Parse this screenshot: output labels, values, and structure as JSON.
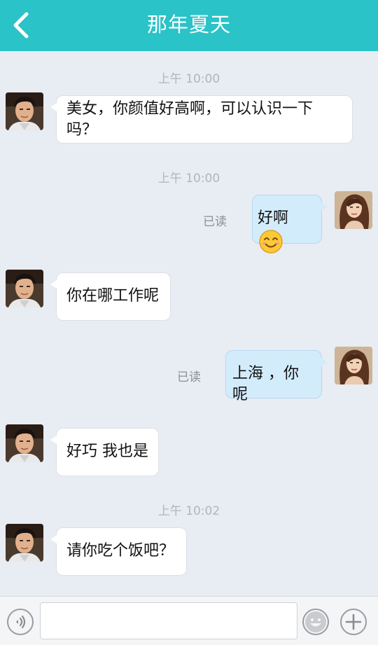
{
  "header": {
    "title": "那年夏天",
    "back_icon": "back-chevron-icon",
    "background": "#2ac3c7"
  },
  "messages": [
    {
      "time": "上午 10:00",
      "side": "left",
      "text_line1": "美女，你颜值好高啊，可以认识一下",
      "text_line2": "吗？"
    },
    {
      "time": "上午 10:00",
      "side": "right",
      "text": "好啊",
      "emoji": "smile-emoji-icon",
      "read": "已读"
    },
    {
      "side": "left",
      "text": "你在哪工作呢"
    },
    {
      "side": "right",
      "text": "上海 ，你呢",
      "read": "已读"
    },
    {
      "side": "left",
      "text": "好巧 我也是"
    },
    {
      "time": "上午 10:02",
      "side": "left",
      "text": "请你吃个饭吧？"
    }
  ],
  "inputbar": {
    "placeholder": "",
    "voice_icon": "voice-icon",
    "emoji_icon": "emoji-face-icon",
    "add_icon": "plus-icon"
  },
  "colors": {
    "bubble_left": "#ffffff",
    "bubble_right": "#d3ecfc",
    "background": "#e8ecf3"
  }
}
